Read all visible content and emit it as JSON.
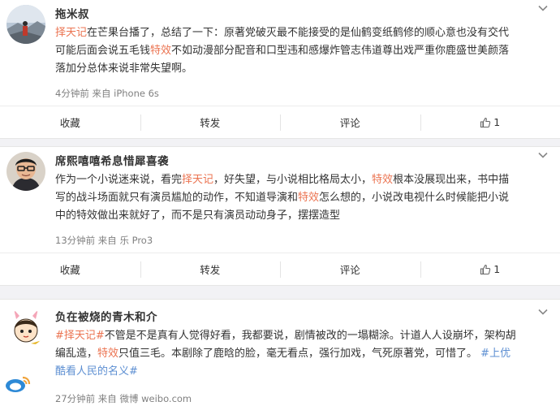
{
  "posts": [
    {
      "author": "拖米叔",
      "lines": [
        [
          {
            "t": "择天记",
            "c": "hl"
          },
          {
            "t": "在芒果台播了，总结了一下：原著党破灭最不能接受的是仙鹤变纸鹤修的顺心意也没有交代"
          }
        ],
        [
          {
            "t": "可能后面会说五毛钱"
          },
          {
            "t": "特效",
            "c": "hl"
          },
          {
            "t": "不如动漫部分配音和口型违和感爆炸管志伟道尊出戏严重你鹿盛世美颜落"
          }
        ],
        [
          {
            "t": "落加分总体来说非常失望啊。"
          }
        ]
      ],
      "meta": "4分钟前 来自 iPhone 6s",
      "actions": {
        "collect": "收藏",
        "repost": "转发",
        "comment": "评论",
        "likes": "1"
      }
    },
    {
      "author": "席熙嘻嘻希息惜犀喜袭",
      "lines": [
        [
          {
            "t": "作为一个小说迷来说，看完"
          },
          {
            "t": "择天记",
            "c": "hl"
          },
          {
            "t": "，好失望，与小说相比格局太小，"
          },
          {
            "t": "特效",
            "c": "hl"
          },
          {
            "t": "根本没展现出来，书中描"
          }
        ],
        [
          {
            "t": "写的战斗场面就只有演员尴尬的动作，不知道导演和"
          },
          {
            "t": "特效",
            "c": "hl"
          },
          {
            "t": "怎么想的，小说改电视什么时候能把小说"
          }
        ],
        [
          {
            "t": "中的特效做出来就好了，而不是只有演员动动身子，摆摆造型"
          }
        ]
      ],
      "meta": "13分钟前 来自 乐 Pro3",
      "actions": {
        "collect": "收藏",
        "repost": "转发",
        "comment": "评论",
        "likes": "1"
      }
    },
    {
      "author": "负在被烧的青木和介",
      "lines": [
        [
          {
            "t": "#择天记#",
            "c": "tag"
          },
          {
            "t": "不管是不是真有人觉得好看，我都要说，剧情被改的一塌糊涂。计道人人设崩坏，架构胡"
          }
        ],
        [
          {
            "t": "编乱造，"
          },
          {
            "t": "特效",
            "c": "hl"
          },
          {
            "t": "只值三毛。本剧除了鹿晗的脸，毫无看点，强行加戏，气死原著党，可惜了。 "
          },
          {
            "t": "#上优",
            "c": "lk"
          }
        ],
        [
          {
            "t": "酷看人民的名义#",
            "c": "lk"
          }
        ]
      ],
      "meta": "27分钟前 来自 微博 weibo.com"
    }
  ]
}
